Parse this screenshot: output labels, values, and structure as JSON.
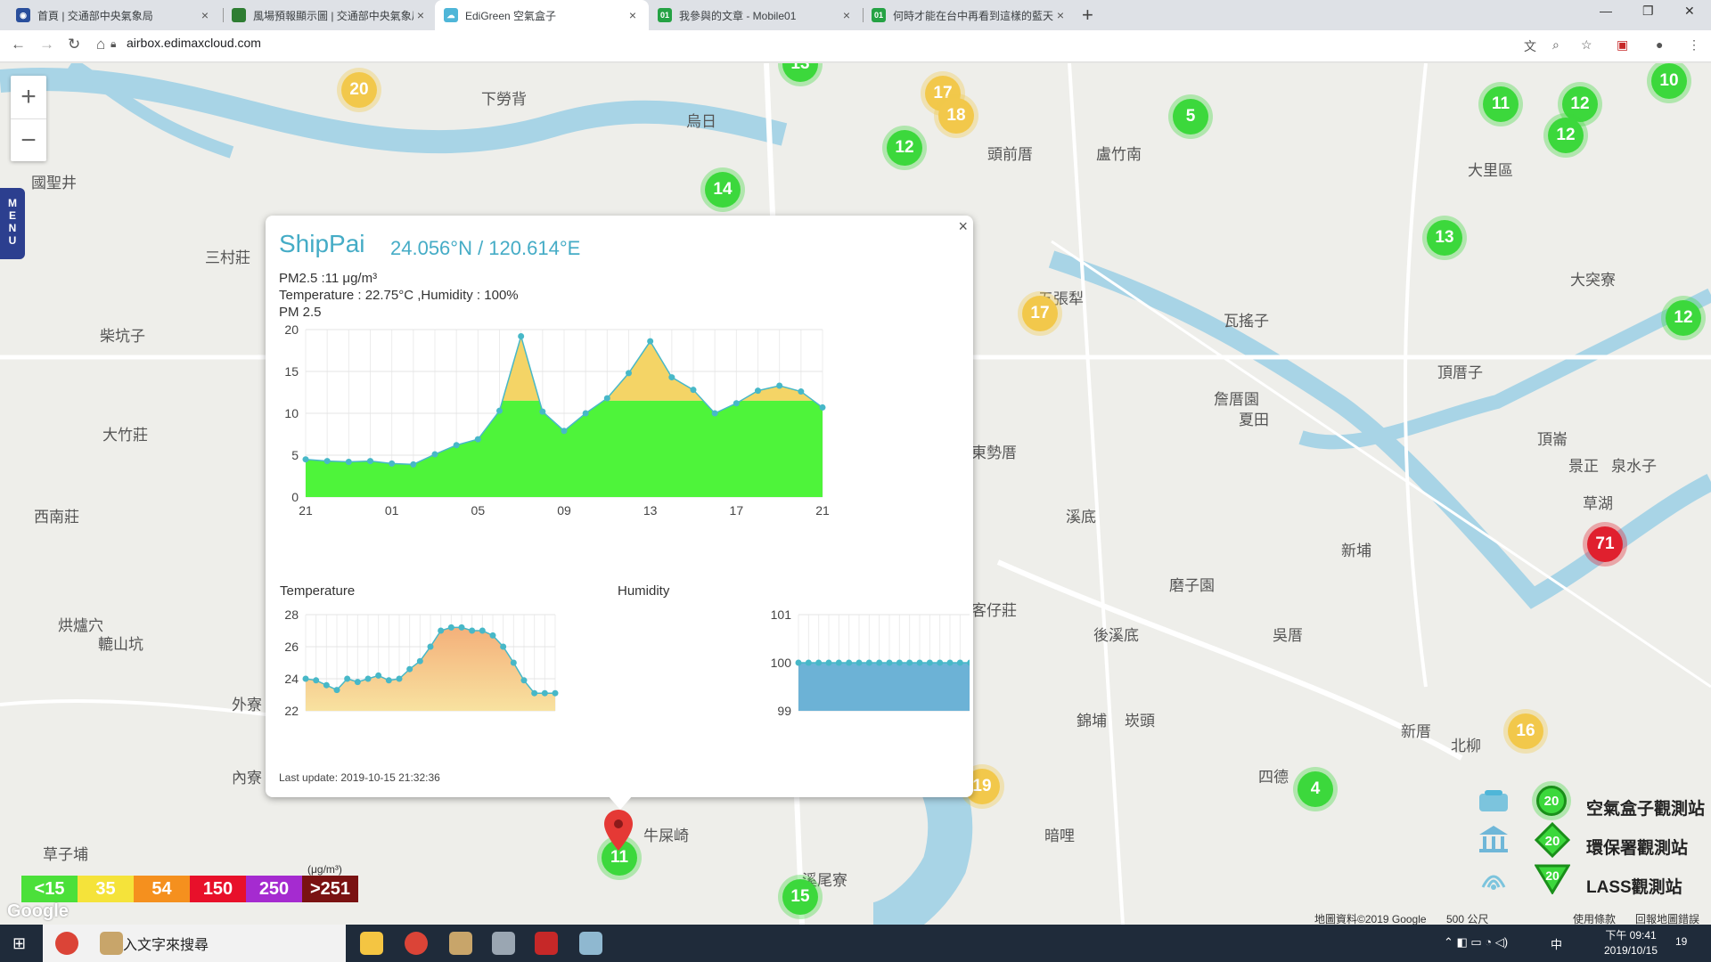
{
  "tabs": [
    {
      "title": "首頁 | 交通部中央氣象局",
      "icon": "eye-icon",
      "color": "#2a4f9c"
    },
    {
      "title": "風場預報顯示圖 | 交通部中央氣象局",
      "icon": "sheet-icon",
      "color": "#2e7d32"
    },
    {
      "title": "EdiGreen 空氣盒子",
      "icon": "cloud-icon",
      "color": "#4fb6d8"
    },
    {
      "title": "我參與的文章 - Mobile01",
      "icon": "m01-icon",
      "color": "#25a244"
    },
    {
      "title": "何時才能在台中再看到這樣的藍天",
      "icon": "m01-icon",
      "color": "#25a244"
    }
  ],
  "url": "airbox.edimaxcloud.com",
  "menu_label": "MENU",
  "zoom": {
    "plus": "+",
    "minus": "−"
  },
  "popup": {
    "name": "ShipPai",
    "coords": "24.056°N / 120.614°E",
    "pm_line": "PM2.5 :11 μg/m³",
    "temp_line": "Temperature : 22.75°C ,Humidity : 100%",
    "pm_title": "PM 2.5",
    "temp_title": "Temperature",
    "hum_title": "Humidity",
    "last_update": "Last update: 2019-10-15 21:32:36",
    "close": "×"
  },
  "chart_data": [
    {
      "type": "area",
      "title": "PM 2.5",
      "x_ticks": [
        "21",
        "01",
        "05",
        "09",
        "13",
        "17",
        "21"
      ],
      "ylim": [
        0,
        20
      ],
      "y_ticks": [
        0,
        5,
        10,
        15,
        20
      ],
      "threshold": 11.5,
      "colors": {
        "below": "#4ef43a",
        "above": "#f4d466",
        "point": "#47b8c8"
      },
      "values": [
        4.5,
        4.3,
        4.2,
        4.3,
        4.0,
        3.9,
        5.1,
        6.2,
        6.9,
        10.3,
        19.2,
        10.2,
        7.9,
        10.0,
        11.8,
        14.8,
        18.6,
        14.3,
        12.8,
        10.0,
        11.2,
        12.7,
        13.3,
        12.6,
        10.7
      ]
    },
    {
      "type": "area",
      "title": "Temperature",
      "ylim": [
        22,
        28
      ],
      "y_ticks": [
        22,
        24,
        26,
        28
      ],
      "colors": {
        "fill_top": "#f4b07a",
        "fill_bottom": "#f8e2a0",
        "point": "#47b8c8"
      },
      "values": [
        24.0,
        23.9,
        23.6,
        23.3,
        24.0,
        23.8,
        24.0,
        24.2,
        23.9,
        24.0,
        24.6,
        25.1,
        26.0,
        27.0,
        27.2,
        27.2,
        27.0,
        27.0,
        26.7,
        26.0,
        25.0,
        23.9,
        23.1,
        23.1,
        23.1
      ]
    },
    {
      "type": "area",
      "title": "Humidity",
      "ylim": [
        99,
        101
      ],
      "y_ticks": [
        99,
        100,
        101
      ],
      "colors": {
        "fill": "#6cb2d6",
        "point": "#47b8c8"
      },
      "values": [
        100,
        100,
        100,
        100,
        100,
        100,
        100,
        100,
        100,
        100,
        100,
        100,
        100,
        100,
        100,
        100,
        100,
        100,
        100,
        100,
        100,
        100,
        100,
        100,
        100
      ]
    }
  ],
  "markers": [
    {
      "v": "20",
      "c": "y"
    },
    {
      "v": "13",
      "c": "g"
    },
    {
      "v": "17",
      "c": "y"
    },
    {
      "v": "18",
      "c": "y"
    },
    {
      "v": "12",
      "c": "g"
    },
    {
      "v": "14",
      "c": "g"
    },
    {
      "v": "5",
      "c": "g"
    },
    {
      "v": "11",
      "c": "g"
    },
    {
      "v": "12",
      "c": "g"
    },
    {
      "v": "12",
      "c": "g"
    },
    {
      "v": "10",
      "c": "g"
    },
    {
      "v": "13",
      "c": "g"
    },
    {
      "v": "12",
      "c": "g"
    },
    {
      "v": "17",
      "c": "y"
    },
    {
      "v": "71",
      "c": "r"
    },
    {
      "v": "16",
      "c": "y"
    },
    {
      "v": "4",
      "c": "g"
    },
    {
      "v": "19",
      "c": "y"
    },
    {
      "v": "11",
      "c": "g"
    },
    {
      "v": "15",
      "c": "g"
    }
  ],
  "map_labels": [
    "下勞背",
    "烏日",
    "頭前厝",
    "盧竹南",
    "大里區",
    "國聖井",
    "三村莊",
    "五張犁",
    "瓦搖子",
    "頂厝子",
    "大突寮",
    "柴坑子",
    "大竹莊",
    "西南莊",
    "夏田",
    "詹厝園",
    "頂崙",
    "景正",
    "泉水子",
    "草湖",
    "東勢厝",
    "溪底",
    "新埔",
    "磨子園",
    "後溪底",
    "吳厝",
    "烘爐穴",
    "轆山坑",
    "錦埔",
    "崁頭",
    "新厝",
    "北柳",
    "四德",
    "暗哩",
    "外寮",
    "內寮",
    "草子埔",
    "牛屎崎",
    "溪尾寮",
    "客仔莊",
    "國聖"
  ],
  "legend": [
    {
      "label": "<15",
      "color": "#4be03a"
    },
    {
      "label": "35",
      "color": "#f5e33a"
    },
    {
      "label": "54",
      "color": "#f5901e"
    },
    {
      "label": "150",
      "color": "#e8102a"
    },
    {
      "label": "250",
      "color": "#a52bd0"
    },
    {
      "label": ">251",
      "color": "#7a1212"
    }
  ],
  "legend_unit": "(μg/m³)",
  "station_legend": [
    {
      "label": "空氣盒子觀測站",
      "icon": "airbox-icon",
      "value": "20"
    },
    {
      "label": "環保署觀測站",
      "icon": "epa-building-icon",
      "value": "20"
    },
    {
      "label": "LASS觀測站",
      "icon": "lass-antenna-icon",
      "value": "20"
    }
  ],
  "map_footer": {
    "google": "Google",
    "attribution": "地圖資料©2019 Google",
    "scale": "500 公尺",
    "terms": "使用條款",
    "report": "回報地圖錯誤"
  },
  "taskbar": {
    "search_placeholder": "入文字來搜尋",
    "time_top": "下午 09:41",
    "date": "2019/10/15",
    "notif_count": "19",
    "ime": "中"
  }
}
